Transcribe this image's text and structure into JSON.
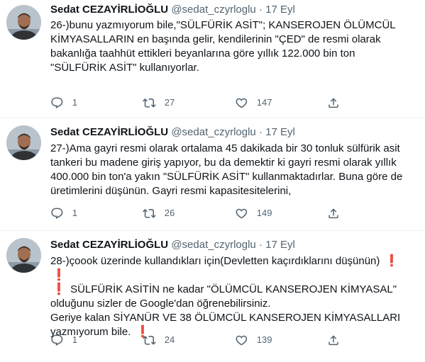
{
  "colors": {
    "text": "#0f1419",
    "secondary": "#536471",
    "divider": "#eff3f4",
    "emoji_red": "#dd2e44"
  },
  "icons": {
    "reply": "reply-icon",
    "retweet": "retweet-icon",
    "like": "heart-icon",
    "share": "share-icon",
    "emoji": "red-exclamation-mark"
  },
  "tweets": [
    {
      "author": {
        "name": "Sedat CEZAYİRLİOĞLU",
        "handle": "@sedat_czyrloglu"
      },
      "separator": "·",
      "date": "17 Eyl",
      "text_lines": [
        "26-)bunu yazmıyorum bile,\"SÜLFÜRİK ASİT\"; KANSEROJEN ÖLÜMCÜL",
        "KİMYASALLARIN en başında gelir, kendilerinin \"ÇED\" de resmi olarak",
        "bakanlığa taahhüt ettikleri beyanlarına göre yıllık 122.000 bin ton",
        "\"SÜLFÜRİK ASİT\" kullanıyorlar."
      ],
      "replies": "1",
      "retweets": "27",
      "likes": "147"
    },
    {
      "author": {
        "name": "Sedat CEZAYİRLİOĞLU",
        "handle": "@sedat_czyrloglu"
      },
      "separator": "·",
      "date": "17 Eyl",
      "text_lines": [
        "27-)Ama gayri resmi olarak ortalama 45 dakikada bir 30 tonluk sülfürik asit",
        "tankeri bu madene giriş yapıyor, bu da demektir ki gayri resmi olarak yıllık",
        "400.000 bin ton'a yakın \"SÜLFÜRİK ASİT\" kullanmaktadırlar. Buna göre de",
        "üretimlerini düşünün. Gayri resmi kapasitesitelerini,"
      ],
      "replies": "1",
      "retweets": "26",
      "likes": "149"
    },
    {
      "author": {
        "name": "Sedat CEZAYİRLİOĞLU",
        "handle": "@sedat_czyrloglu"
      },
      "separator": "·",
      "date": "17 Eyl",
      "text_parts": {
        "line1": "28-)çoook üzerinde kullandıkları için(Devletten kaçırdıklarını düşünün)",
        "line2": " SÜLFÜRİK ASİTİN ne kadar \"ÖLÜMCÜL KANSEROJEN KİMYASAL\"",
        "line3": "olduğunu sizler de Google'dan öğrenebilirsiniz.",
        "line4": "Geriye kalan SİYANÜR VE 38 ÖLÜMCÜL KANSEROJEN KİMYASALLARI",
        "line5": "yazmıyorum bile.",
        "emoji": "❗"
      },
      "replies": "1",
      "retweets": "24",
      "likes": "139"
    }
  ]
}
